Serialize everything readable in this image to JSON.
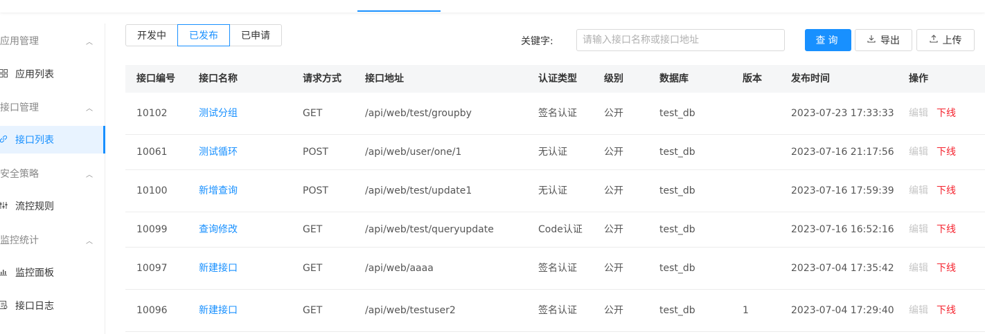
{
  "sidebar": {
    "groups": [
      {
        "label": "应用管理"
      },
      {
        "label": "接口管理"
      },
      {
        "label": "安全策略"
      },
      {
        "label": "监控统计"
      }
    ],
    "items": [
      {
        "label": "应用列表",
        "icon": "grid-icon"
      },
      {
        "label": "接口列表",
        "icon": "link-icon"
      },
      {
        "label": "流控规则",
        "icon": "flow-control-icon"
      },
      {
        "label": "监控面板",
        "icon": "bar-chart-icon"
      },
      {
        "label": "接口日志",
        "icon": "log-icon"
      }
    ]
  },
  "tabs": [
    {
      "label": "开发中"
    },
    {
      "label": "已发布"
    },
    {
      "label": "已申请"
    }
  ],
  "search": {
    "label": "关键字:",
    "placeholder": "请输入接口名称或接口地址",
    "query_label": "查询",
    "export_label": "导出",
    "upload_label": "上传"
  },
  "table": {
    "headers": [
      "接口编号",
      "接口名称",
      "请求方式",
      "接口地址",
      "认证类型",
      "级别",
      "数据库",
      "版本",
      "发布时间",
      "操作"
    ],
    "rows": [
      {
        "id": "10102",
        "name": "测试分组",
        "method": "GET",
        "path": "/api/web/test/groupby",
        "auth": "签名认证",
        "level": "公开",
        "db": "test_db",
        "version": "",
        "time": "2023-07-23 17:33:33",
        "edit": "编辑",
        "offline": "下线"
      },
      {
        "id": "10061",
        "name": "测试循环",
        "method": "POST",
        "path": "/api/web/user/one/1",
        "auth": "无认证",
        "level": "公开",
        "db": "test_db",
        "version": "",
        "time": "2023-07-16 21:17:56",
        "edit": "编辑",
        "offline": "下线"
      },
      {
        "id": "10100",
        "name": "新增查询",
        "method": "POST",
        "path": "/api/web/test/update1",
        "auth": "无认证",
        "level": "公开",
        "db": "test_db",
        "version": "",
        "time": "2023-07-16 17:59:39",
        "edit": "编辑",
        "offline": "下线"
      },
      {
        "id": "10099",
        "name": "查询修改",
        "method": "GET",
        "path": "/api/web/test/queryupdate",
        "auth": "Code认证",
        "level": "公开",
        "db": "test_db",
        "version": "",
        "time": "2023-07-16 16:52:16",
        "edit": "编辑",
        "offline": "下线"
      },
      {
        "id": "10097",
        "name": "新建接口",
        "method": "GET",
        "path": "/api/web/aaaa",
        "auth": "签名认证",
        "level": "公开",
        "db": "test_db",
        "version": "",
        "time": "2023-07-04 17:35:42",
        "edit": "编辑",
        "offline": "下线"
      },
      {
        "id": "10096",
        "name": "新建接口",
        "method": "GET",
        "path": "/api/web/testuser2",
        "auth": "签名认证",
        "level": "公开",
        "db": "test_db",
        "version": "1",
        "time": "2023-07-04 17:29:40",
        "edit": "编辑",
        "offline": "下线"
      }
    ]
  },
  "colors": {
    "accent": "#1890ff",
    "danger": "#f5222d"
  }
}
